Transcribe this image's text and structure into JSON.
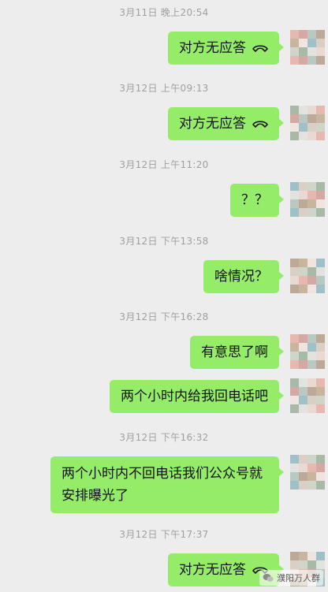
{
  "messages": [
    {
      "time": "3月11日 晚上20:54",
      "text": "对方无应答",
      "phone": true
    },
    {
      "time": "3月12日 上午09:13",
      "text": "对方无应答",
      "phone": true
    },
    {
      "time": "3月12日 上午11:20",
      "text": "？？",
      "phone": false
    },
    {
      "time": "3月12日 下午13:58",
      "text": "啥情况？",
      "phone": false
    },
    {
      "time": "3月12日 下午16:28",
      "text": "有意思了啊",
      "phone": false
    },
    {
      "time": "",
      "text": "两个小时内给我回电话吧",
      "phone": false
    },
    {
      "time": "3月12日 下午16:32",
      "text": "两个小时内不回电话我们公众号就安排曝光了",
      "phone": false
    },
    {
      "time": "3月12日 下午17:37",
      "text": "对方无应答",
      "phone": true
    }
  ],
  "watermark": {
    "text": "濮阳万人群",
    "icon": "wechat-icon"
  },
  "colors": {
    "bubble": "#95ec69",
    "background": "#ededed",
    "timestamp": "#a0a0a0"
  }
}
